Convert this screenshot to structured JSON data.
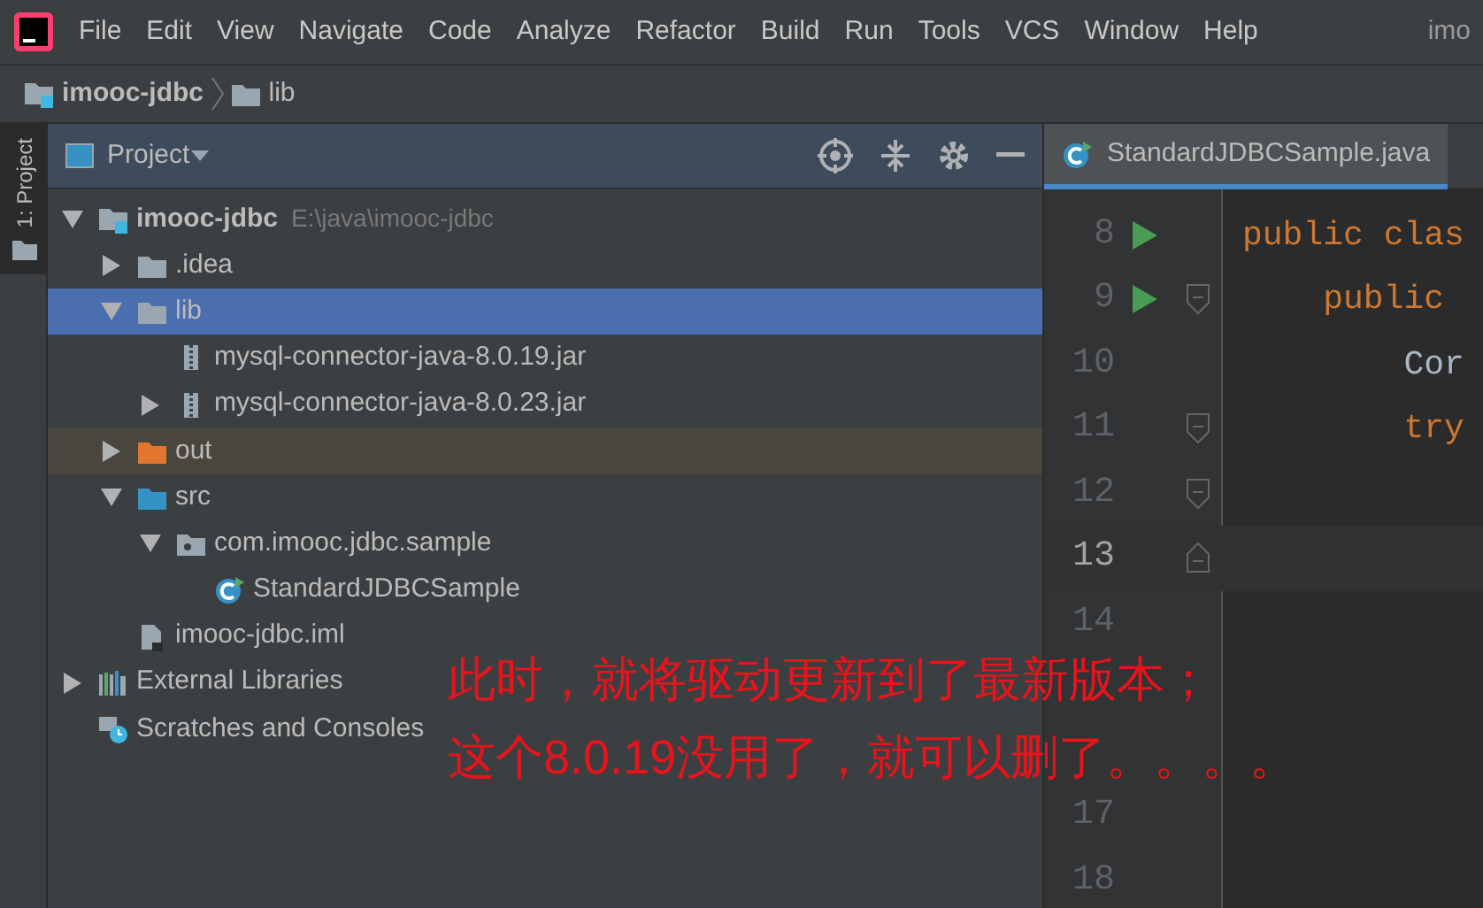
{
  "menu_bar": {
    "items": [
      "File",
      "Edit",
      "View",
      "Navigate",
      "Code",
      "Analyze",
      "Refactor",
      "Build",
      "Run",
      "Tools",
      "VCS",
      "Window",
      "Help"
    ],
    "title": "imo"
  },
  "breadcrumb": [
    {
      "kind": "module",
      "label": "imooc-jdbc"
    },
    {
      "kind": "folder",
      "label": "lib"
    }
  ],
  "tool_stripe": {
    "label": "1: Project"
  },
  "project_panel": {
    "title": "Project",
    "tree": [
      {
        "kind": "module",
        "label": "imooc-jdbc",
        "path": "E:\\java\\imooc-jdbc",
        "expanded": true,
        "selected": false,
        "children": [
          {
            "kind": "folder",
            "label": ".idea",
            "expanded": false,
            "selected": false
          },
          {
            "kind": "folder",
            "label": "lib",
            "expanded": true,
            "selected": true,
            "children": [
              {
                "kind": "jar",
                "label": "mysql-connector-java-8.0.19.jar",
                "selected": false
              },
              {
                "kind": "jar",
                "label": "mysql-connector-java-8.0.23.jar",
                "expanded": false,
                "selected": false
              }
            ]
          },
          {
            "kind": "excluded-folder",
            "label": "out",
            "expanded": false,
            "selected": false
          },
          {
            "kind": "source-folder",
            "label": "src",
            "expanded": true,
            "selected": false,
            "children": [
              {
                "kind": "package",
                "label": "com.imooc.jdbc.sample",
                "expanded": true,
                "selected": false,
                "children": [
                  {
                    "kind": "class",
                    "label": "StandardJDBCSample",
                    "selected": false
                  }
                ]
              }
            ]
          },
          {
            "kind": "file",
            "label": "imooc-jdbc.iml",
            "selected": false
          }
        ]
      },
      {
        "kind": "libraries",
        "label": "External Libraries",
        "expanded": false,
        "selected": false
      },
      {
        "kind": "scratches",
        "label": "Scratches and Consoles",
        "selected": false
      }
    ]
  },
  "editor": {
    "tabs": [
      {
        "label": "StandardJDBCSample.java",
        "selected": true
      }
    ],
    "lines": [
      {
        "number": "8",
        "run": true,
        "kind": "plain",
        "current": false,
        "code": "public clas",
        "keyword": true
      },
      {
        "number": "9",
        "run": true,
        "kind": "fold-start",
        "current": false,
        "code": "    public",
        "keyword": true
      },
      {
        "number": "10",
        "run": false,
        "kind": "plain",
        "current": false,
        "code": "        Cor",
        "keyword": false
      },
      {
        "number": "11",
        "run": false,
        "kind": "fold-start",
        "current": false,
        "code": "        try",
        "keyword": true
      },
      {
        "number": "12",
        "run": false,
        "kind": "fold-start",
        "current": false
      },
      {
        "number": "13",
        "run": false,
        "kind": "fold-end",
        "current": true
      },
      {
        "number": "14",
        "run": false,
        "kind": "plain",
        "current": false
      },
      {
        "run": false,
        "kind": "plain",
        "current": false
      },
      {
        "run": false,
        "kind": "plain",
        "current": false
      },
      {
        "number": "17",
        "run": false,
        "kind": "plain",
        "current": false
      },
      {
        "number": "18",
        "run": false,
        "kind": "plain",
        "current": false
      }
    ]
  },
  "annotation": {
    "lines": [
      "此时，就将驱动更新到了最新版本；",
      "这个8.0.19没用了，就可以删了。。。。"
    ]
  }
}
